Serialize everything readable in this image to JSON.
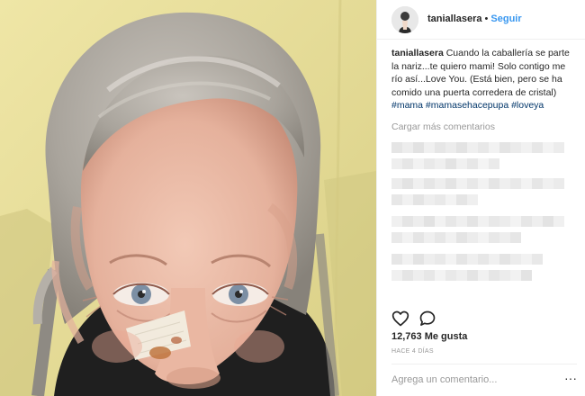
{
  "post": {
    "username": "taniallasera",
    "dot": "•",
    "follow_label": "Seguir",
    "caption_text": "Cuando la caballería se parte la nariz...te quiero mami! Solo contigo me río así...Love You. (Está bien, pero se ha comido una puerta corredera de cristal)",
    "hashtags": "#mama #mamasehacepupa #loveya",
    "load_more": "Cargar más comentarios",
    "likes": "12,763 Me gusta",
    "time": "HACE 4 DÍAS",
    "comment_placeholder": "Agrega un comentario...",
    "more_glyph": "···"
  },
  "icons": {
    "like": "heart-icon",
    "comment": "comment-icon",
    "more": "more-options-icon"
  },
  "colors": {
    "link_blue": "#3897f0",
    "hashtag_blue": "#003569",
    "muted": "#999999",
    "text": "#262626",
    "photo_background": "#e6dd9c"
  }
}
